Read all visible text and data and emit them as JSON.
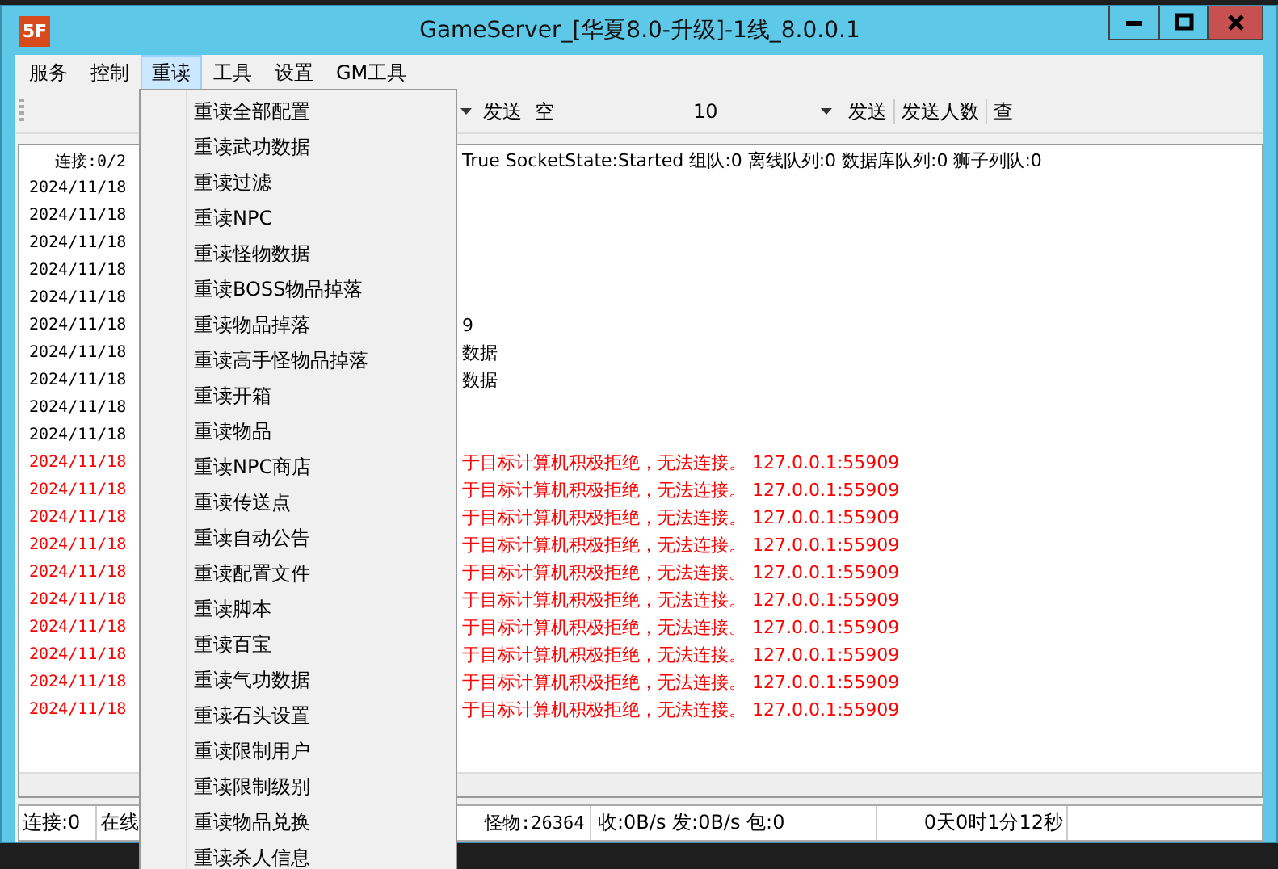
{
  "window": {
    "title": "GameServer_[华夏8.0-升级]-1线_8.0.0.1",
    "app_icon": "5F"
  },
  "menu_bar": [
    {
      "label": "服务",
      "selected": false
    },
    {
      "label": "控制",
      "selected": false
    },
    {
      "label": "重读",
      "selected": true
    },
    {
      "label": "工具",
      "selected": false
    },
    {
      "label": "设置",
      "selected": false
    },
    {
      "label": "GM工具",
      "selected": false
    }
  ],
  "toolbar": {
    "send_button_1": "发送",
    "field_value": "空",
    "count_value": "10",
    "send_button_2": "发送",
    "send_count_button": "发送人数",
    "query_button": "查"
  },
  "log": {
    "header_left": "连接:0/2",
    "header_right": "True  SocketState:Started  组队:0  离线队列:0  数据库队列:0  狮子列队:0",
    "rows": [
      {
        "kind": "info",
        "date": "2024/11/18"
      },
      {
        "kind": "info",
        "date": "2024/11/18"
      },
      {
        "kind": "info",
        "date": "2024/11/18"
      },
      {
        "kind": "info",
        "date": "2024/11/18"
      },
      {
        "kind": "info",
        "date": "2024/11/18"
      },
      {
        "kind": "info",
        "date": "2024/11/18",
        "tail": "9"
      },
      {
        "kind": "info",
        "date": "2024/11/18",
        "tail": "数据"
      },
      {
        "kind": "info",
        "date": "2024/11/18",
        "tail": "数据"
      },
      {
        "kind": "info",
        "date": "2024/11/18"
      },
      {
        "kind": "info",
        "date": "2024/11/18"
      },
      {
        "kind": "error",
        "date": "2024/11/18",
        "tail": "于目标计算机积极拒绝，无法连接。 127.0.0.1:55909"
      },
      {
        "kind": "error",
        "date": "2024/11/18",
        "tail": "于目标计算机积极拒绝，无法连接。 127.0.0.1:55909"
      },
      {
        "kind": "error",
        "date": "2024/11/18",
        "tail": "于目标计算机积极拒绝，无法连接。 127.0.0.1:55909"
      },
      {
        "kind": "error",
        "date": "2024/11/18",
        "tail": "于目标计算机积极拒绝，无法连接。 127.0.0.1:55909"
      },
      {
        "kind": "error",
        "date": "2024/11/18",
        "tail": "于目标计算机积极拒绝，无法连接。 127.0.0.1:55909"
      },
      {
        "kind": "error",
        "date": "2024/11/18",
        "tail": "于目标计算机积极拒绝，无法连接。 127.0.0.1:55909"
      },
      {
        "kind": "error",
        "date": "2024/11/18",
        "tail": "于目标计算机积极拒绝，无法连接。 127.0.0.1:55909"
      },
      {
        "kind": "error",
        "date": "2024/11/18",
        "tail": "于目标计算机积极拒绝，无法连接。 127.0.0.1:55909"
      },
      {
        "kind": "error",
        "date": "2024/11/18",
        "tail": "于目标计算机积极拒绝，无法连接。 127.0.0.1:55909"
      },
      {
        "kind": "error",
        "date": "2024/11/18",
        "tail": "于目标计算机积极拒绝，无法连接。 127.0.0.1:55909"
      }
    ]
  },
  "status_bar": {
    "connections": "连接:0",
    "online": "在线",
    "monsters": "怪物:26364",
    "traffic": "收:0B/s  发:0B/s  包:0",
    "uptime": "0天0时1分12秒"
  },
  "dropdown_menu": [
    "重读全部配置",
    "重读武功数据",
    "重读过滤",
    "重读NPC",
    "重读怪物数据",
    "重读BOSS物品掉落",
    "重读物品掉落",
    "重读高手怪物品掉落",
    "重读开箱",
    "重读物品",
    "重读NPC商店",
    "重读传送点",
    "重读自动公告",
    "重读配置文件",
    "重读脚本",
    "重读百宝",
    "重读气功数据",
    "重读石头设置",
    "重读限制用户",
    "重读限制级别",
    "重读物品兑换",
    "重读杀人信息"
  ]
}
